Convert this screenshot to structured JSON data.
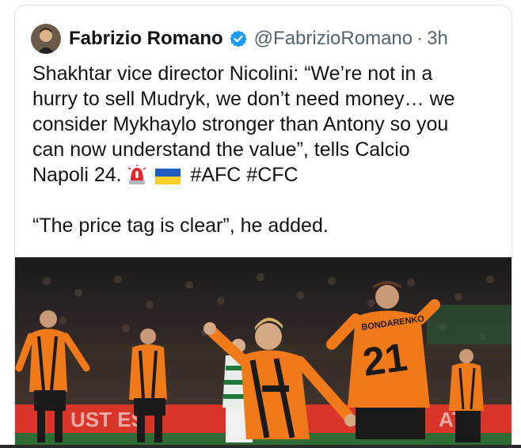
{
  "tweet": {
    "author_name": "Fabrizio Romano",
    "handle": "@FabrizioRomano",
    "separator": "·",
    "time": "3h",
    "body_line_1": "Shakhtar vice director Nicolini: “We’re not in a",
    "body_line_2": "hurry to sell Mudryk, we don’t need money… we",
    "body_line_3": "consider Mykhaylo stronger than Antony so you",
    "body_line_4": "can now understand the value”, tells Calcio",
    "body_line_5_text": "Napoli 24.",
    "hashtags": "#AFC #CFC",
    "quote": "“The price tag is clear”, he added.",
    "emojis": [
      "police-siren-emoji",
      "ukraine-flag-emoji"
    ]
  },
  "photo": {
    "shirt_name": "BONDARENKO",
    "shirt_number": "21",
    "board_text_left": "UST ES",
    "board_text_right": "AT"
  },
  "colors": {
    "text": "#0f1419",
    "secondary": "#536471",
    "verified": "#1d9bf0",
    "kit_orange": "#f07a1a",
    "board_red": "#d9352b"
  }
}
